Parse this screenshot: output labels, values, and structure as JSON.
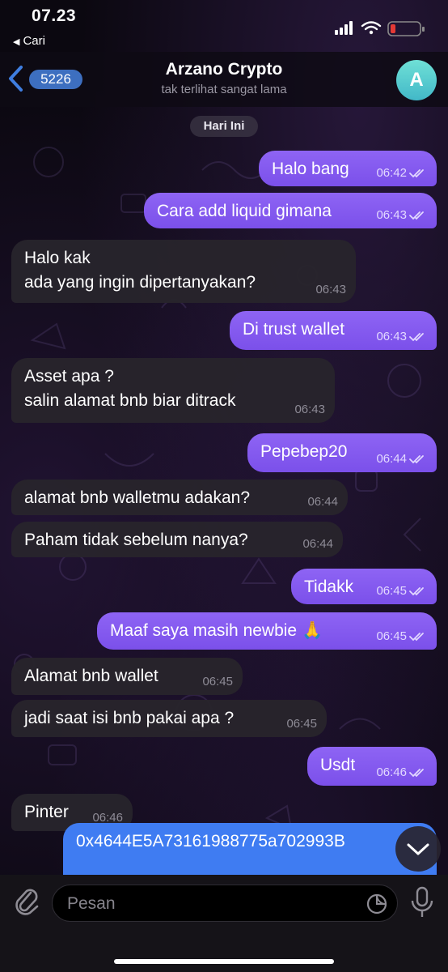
{
  "status_bar": {
    "time": "07.23",
    "back_app": "Cari",
    "battery_color": "#e53935"
  },
  "header": {
    "unread_count": "5226",
    "title": "Arzano Crypto",
    "subtitle": "tak terlihat sangat lama",
    "avatar_letter": "A",
    "accent_color": "#3d6fc0"
  },
  "date_label": "Hari Ini",
  "messages": [
    {
      "dir": "out",
      "lines": [
        "Halo bang"
      ],
      "time": "06:42",
      "read": true
    },
    {
      "dir": "out",
      "lines": [
        "Cara add liquid gimana"
      ],
      "time": "06:43",
      "read": true
    },
    {
      "dir": "in",
      "lines": [
        "Halo kak",
        "ada yang ingin dipertanyakan?"
      ],
      "time": "06:43"
    },
    {
      "dir": "out",
      "lines": [
        "Di trust wallet"
      ],
      "time": "06:43",
      "read": true
    },
    {
      "dir": "in",
      "lines": [
        "Asset apa ?",
        "salin alamat bnb biar ditrack"
      ],
      "time": "06:43"
    },
    {
      "dir": "out",
      "lines": [
        "Pepebep20"
      ],
      "time": "06:44",
      "read": true
    },
    {
      "dir": "in",
      "lines": [
        "alamat bnb walletmu adakan?"
      ],
      "time": "06:44"
    },
    {
      "dir": "in",
      "lines": [
        "Paham tidak sebelum nanya?"
      ],
      "time": "06:44"
    },
    {
      "dir": "out",
      "lines": [
        "Tidakk"
      ],
      "time": "06:45",
      "read": true
    },
    {
      "dir": "out",
      "lines": [
        "Maaf saya masih newbie 🙏"
      ],
      "time": "06:45",
      "read": true
    },
    {
      "dir": "in",
      "lines": [
        "Alamat bnb wallet"
      ],
      "time": "06:45"
    },
    {
      "dir": "in",
      "lines": [
        "jadi saat isi bnb pakai apa ?"
      ],
      "time": "06:45"
    },
    {
      "dir": "out",
      "lines": [
        "Usdt"
      ],
      "time": "06:46",
      "read": true
    },
    {
      "dir": "in",
      "lines": [
        "Pinter"
      ],
      "time": "06:46"
    }
  ],
  "partial_message": {
    "text": "0x4644E5A73161988775a702993B"
  },
  "input": {
    "placeholder": "Pesan"
  },
  "colors": {
    "outgoing": "#8a5ff2",
    "incoming": "#28242c",
    "address_bubble": "#3f7cf2"
  }
}
